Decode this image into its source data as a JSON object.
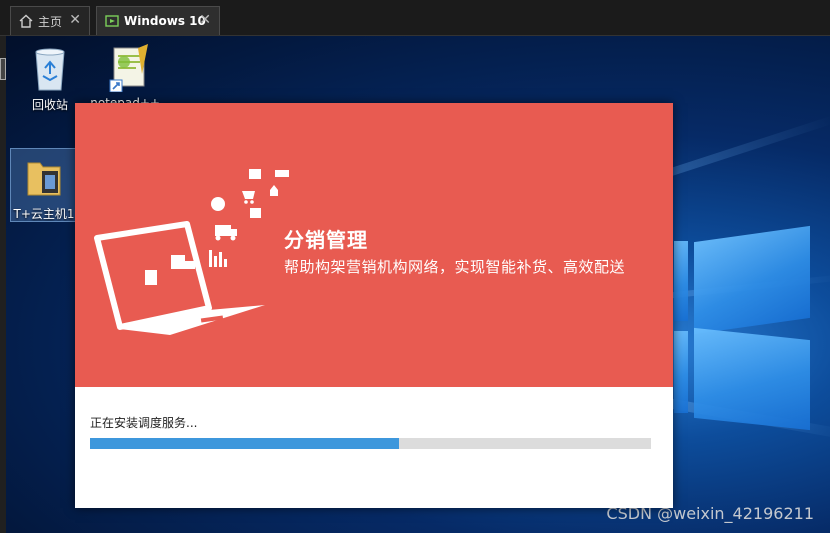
{
  "tabs": [
    {
      "label": "主页",
      "icon": "home-icon",
      "close": "✕"
    },
    {
      "label": "Windows 10",
      "icon": "vm-icon",
      "close": "✕"
    }
  ],
  "desktop_icons": [
    {
      "label": "回收站",
      "icon": "recycle-bin-icon"
    },
    {
      "label": "notepad++ –",
      "icon": "notepad-plus-plus-icon"
    },
    {
      "label": "T+云主机1",
      "icon": "folder-icon"
    }
  ],
  "installer": {
    "title": "分销管理",
    "subtitle": "帮助构架营销机构网络，实现智能补货、高效配送",
    "status": "正在安装调度服务...",
    "progress": 0.55
  },
  "watermark": "CSDN @weixin_42196211",
  "colors": {
    "banner": "#e85b51",
    "progress_fill": "#3d97dc",
    "progress_track": "#dcdcdc"
  }
}
